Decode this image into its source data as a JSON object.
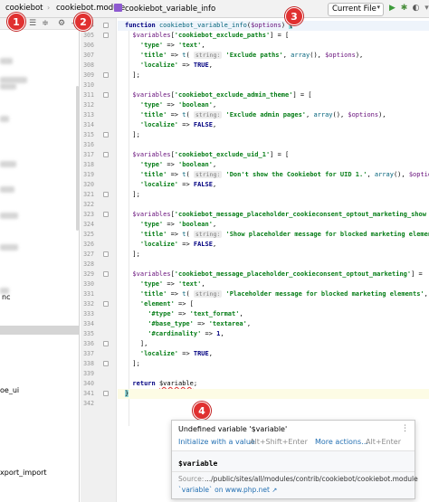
{
  "breadcrumbs": [
    "cookiebot",
    "cookiebot.module",
    "cookiebot_variable_info"
  ],
  "run_config": {
    "label": "Current File"
  },
  "project_tree": {
    "items": [
      "nc",
      "oe_ui",
      "xport_import"
    ]
  },
  "markers": [
    "1",
    "2",
    "3",
    "4"
  ],
  "editor": {
    "lines": [
      {
        "n": "304",
        "segs": [
          [
            "kw",
            "function "
          ],
          [
            "fn",
            "cookiebot_variable_info"
          ],
          [
            "plain",
            "("
          ],
          [
            "var",
            "$options"
          ],
          [
            "plain",
            ") "
          ],
          [
            "brace",
            "{"
          ]
        ]
      },
      {
        "n": "305",
        "segs": [
          [
            "var",
            "  $variables"
          ],
          [
            "plain",
            "["
          ],
          [
            "str",
            "'cookiebot_exclude_paths'"
          ],
          [
            "plain",
            "] = ["
          ]
        ]
      },
      {
        "n": "306",
        "segs": [
          [
            "str",
            "    'type'"
          ],
          [
            "plain",
            " => "
          ],
          [
            "str",
            "'text'"
          ],
          [
            "plain",
            ","
          ]
        ]
      },
      {
        "n": "307",
        "segs": [
          [
            "str",
            "    'title'"
          ],
          [
            "plain",
            " => "
          ],
          [
            "fn",
            "t"
          ],
          [
            "plain",
            "( "
          ],
          [
            "hint",
            "string:"
          ],
          [
            "str",
            " 'Exclude paths'"
          ],
          [
            "plain",
            ", "
          ],
          [
            "fn",
            "array"
          ],
          [
            "plain",
            "(), "
          ],
          [
            "var",
            "$options"
          ],
          [
            "plain",
            "),"
          ]
        ]
      },
      {
        "n": "308",
        "segs": [
          [
            "str",
            "    'localize'"
          ],
          [
            "plain",
            " => "
          ],
          [
            "kw",
            "TRUE"
          ],
          [
            "plain",
            ","
          ]
        ]
      },
      {
        "n": "309",
        "segs": [
          [
            "plain",
            "  ];"
          ]
        ]
      },
      {
        "n": "310",
        "segs": []
      },
      {
        "n": "311",
        "segs": [
          [
            "var",
            "  $variables"
          ],
          [
            "plain",
            "["
          ],
          [
            "str",
            "'cookiebot_exclude_admin_theme'"
          ],
          [
            "plain",
            "] = ["
          ]
        ]
      },
      {
        "n": "312",
        "segs": [
          [
            "str",
            "    'type'"
          ],
          [
            "plain",
            " => "
          ],
          [
            "str",
            "'boolean'"
          ],
          [
            "plain",
            ","
          ]
        ]
      },
      {
        "n": "313",
        "segs": [
          [
            "str",
            "    'title'"
          ],
          [
            "plain",
            " => "
          ],
          [
            "fn",
            "t"
          ],
          [
            "plain",
            "( "
          ],
          [
            "hint",
            "string:"
          ],
          [
            "str",
            " 'Exclude admin pages'"
          ],
          [
            "plain",
            ", "
          ],
          [
            "fn",
            "array"
          ],
          [
            "plain",
            "(), "
          ],
          [
            "var",
            "$options"
          ],
          [
            "plain",
            "),"
          ]
        ]
      },
      {
        "n": "314",
        "segs": [
          [
            "str",
            "    'localize'"
          ],
          [
            "plain",
            " => "
          ],
          [
            "kw",
            "FALSE"
          ],
          [
            "plain",
            ","
          ]
        ]
      },
      {
        "n": "315",
        "segs": [
          [
            "plain",
            "  ];"
          ]
        ]
      },
      {
        "n": "316",
        "segs": []
      },
      {
        "n": "317",
        "segs": [
          [
            "var",
            "  $variables"
          ],
          [
            "plain",
            "["
          ],
          [
            "str",
            "'cookiebot_exclude_uid_1'"
          ],
          [
            "plain",
            "] = ["
          ]
        ]
      },
      {
        "n": "318",
        "segs": [
          [
            "str",
            "    'type'"
          ],
          [
            "plain",
            " => "
          ],
          [
            "str",
            "'boolean'"
          ],
          [
            "plain",
            ","
          ]
        ]
      },
      {
        "n": "319",
        "segs": [
          [
            "str",
            "    'title'"
          ],
          [
            "plain",
            " => "
          ],
          [
            "fn",
            "t"
          ],
          [
            "plain",
            "( "
          ],
          [
            "hint",
            "string:"
          ],
          [
            "str",
            " 'Don't show the Cookiebot for UID 1.'"
          ],
          [
            "plain",
            ", "
          ],
          [
            "fn",
            "array"
          ],
          [
            "plain",
            "(), "
          ],
          [
            "var",
            "$options"
          ]
        ]
      },
      {
        "n": "320",
        "segs": [
          [
            "str",
            "    'localize'"
          ],
          [
            "plain",
            " => "
          ],
          [
            "kw",
            "FALSE"
          ],
          [
            "plain",
            ","
          ]
        ]
      },
      {
        "n": "321",
        "segs": [
          [
            "plain",
            "  ];"
          ]
        ]
      },
      {
        "n": "322",
        "segs": []
      },
      {
        "n": "323",
        "segs": [
          [
            "var",
            "  $variables"
          ],
          [
            "plain",
            "["
          ],
          [
            "str",
            "'cookiebot_message_placeholder_cookieconsent_optout_marketing_show"
          ]
        ]
      },
      {
        "n": "324",
        "segs": [
          [
            "str",
            "    'type'"
          ],
          [
            "plain",
            " => "
          ],
          [
            "str",
            "'boolean'"
          ],
          [
            "plain",
            ","
          ]
        ]
      },
      {
        "n": "325",
        "segs": [
          [
            "str",
            "    'title'"
          ],
          [
            "plain",
            " => "
          ],
          [
            "fn",
            "t"
          ],
          [
            "plain",
            "( "
          ],
          [
            "hint",
            "string:"
          ],
          [
            "str",
            " 'Show placeholder message for blocked marketing elements"
          ]
        ]
      },
      {
        "n": "326",
        "segs": [
          [
            "str",
            "    'localize'"
          ],
          [
            "plain",
            " => "
          ],
          [
            "kw",
            "FALSE"
          ],
          [
            "plain",
            ","
          ]
        ]
      },
      {
        "n": "327",
        "segs": [
          [
            "plain",
            "  ];"
          ]
        ]
      },
      {
        "n": "328",
        "segs": []
      },
      {
        "n": "329",
        "segs": [
          [
            "var",
            "  $variables"
          ],
          [
            "plain",
            "["
          ],
          [
            "str",
            "'cookiebot_message_placeholder_cookieconsent_optout_marketing'"
          ],
          [
            "plain",
            "] = "
          ]
        ]
      },
      {
        "n": "330",
        "segs": [
          [
            "str",
            "    'type'"
          ],
          [
            "plain",
            " => "
          ],
          [
            "str",
            "'text'"
          ],
          [
            "plain",
            ","
          ]
        ]
      },
      {
        "n": "331",
        "segs": [
          [
            "str",
            "    'title'"
          ],
          [
            "plain",
            " => "
          ],
          [
            "fn",
            "t"
          ],
          [
            "plain",
            "( "
          ],
          [
            "hint",
            "string:"
          ],
          [
            "str",
            " 'Placeholder message for blocked marketing elements'"
          ],
          [
            "plain",
            ", "
          ],
          [
            "fn",
            "ar"
          ]
        ]
      },
      {
        "n": "332",
        "segs": [
          [
            "str",
            "    'element'"
          ],
          [
            "plain",
            " => ["
          ]
        ]
      },
      {
        "n": "333",
        "segs": [
          [
            "str",
            "      '#type'"
          ],
          [
            "plain",
            " => "
          ],
          [
            "str",
            "'text_format'"
          ],
          [
            "plain",
            ","
          ]
        ]
      },
      {
        "n": "334",
        "segs": [
          [
            "str",
            "      '#base_type'"
          ],
          [
            "plain",
            " => "
          ],
          [
            "str",
            "'textarea'"
          ],
          [
            "plain",
            ","
          ]
        ]
      },
      {
        "n": "335",
        "segs": [
          [
            "str",
            "      '#cardinality'"
          ],
          [
            "plain",
            " => "
          ],
          [
            "kw",
            "1"
          ],
          [
            "plain",
            ","
          ]
        ]
      },
      {
        "n": "336",
        "segs": [
          [
            "plain",
            "    ],"
          ]
        ]
      },
      {
        "n": "337",
        "segs": [
          [
            "str",
            "    'localize'"
          ],
          [
            "plain",
            " => "
          ],
          [
            "kw",
            "TRUE"
          ],
          [
            "plain",
            ","
          ]
        ]
      },
      {
        "n": "338",
        "segs": [
          [
            "plain",
            "  ];"
          ]
        ]
      },
      {
        "n": "339",
        "segs": []
      },
      {
        "n": "340",
        "segs": [
          [
            "kw",
            "  return "
          ],
          [
            "err",
            "$variable"
          ],
          [
            "plain",
            ";"
          ]
        ]
      },
      {
        "n": "341",
        "segs": [
          [
            "brace",
            "}"
          ]
        ]
      },
      {
        "n": "342",
        "segs": []
      }
    ]
  },
  "popup": {
    "title": "Undefined variable '$variable'",
    "fix_label": "Initialize with a value",
    "fix_shortcut": "Alt+Shift+Enter",
    "more_label": "More actions...",
    "more_shortcut": "Alt+Enter",
    "var_name": "$variable",
    "source_label": "Source:",
    "source_path": ".../public/sites/all/modules/contrib/cookiebot/cookiebot.module",
    "doc_link": "`variable` on www.php.net",
    "doc_arrow": "↗"
  }
}
